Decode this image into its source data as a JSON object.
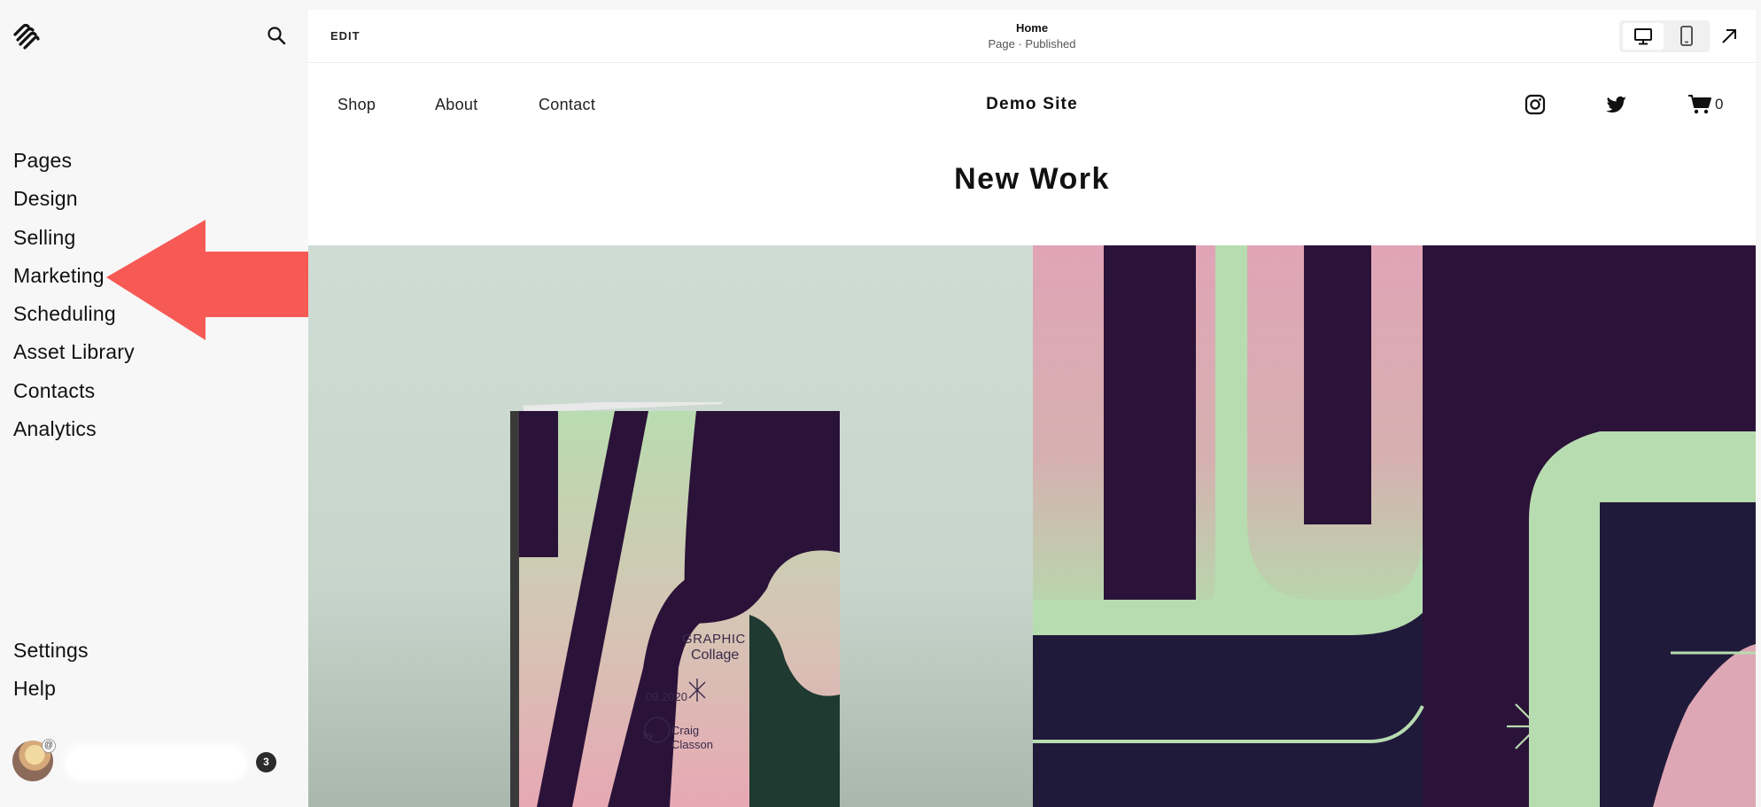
{
  "sidebar": {
    "nav_main": [
      "Pages",
      "Design",
      "Selling",
      "Marketing",
      "Scheduling",
      "Asset Library",
      "Contacts",
      "Analytics"
    ],
    "nav_bottom": [
      "Settings",
      "Help"
    ],
    "notification_count": "3",
    "avatar_badge": "@"
  },
  "editor": {
    "edit_label": "EDIT",
    "page_title": "Home",
    "page_status": "Page · Published"
  },
  "site": {
    "nav": [
      "Shop",
      "About",
      "Contact"
    ],
    "title": "Demo Site",
    "cart_count": "0",
    "section_title": "New Work"
  },
  "gallery": {
    "book_line1": "GRAPHIC",
    "book_line2": "Collage",
    "book_date": "09.2020",
    "book_by": "by",
    "book_author1": "Craig",
    "book_author2": "Classon"
  },
  "colors": {
    "annotation_arrow": "#f75a55",
    "gallery_dark": "#2b1238",
    "gallery_green": "#b7dcb0",
    "gallery_pink": "#dea7b5"
  }
}
